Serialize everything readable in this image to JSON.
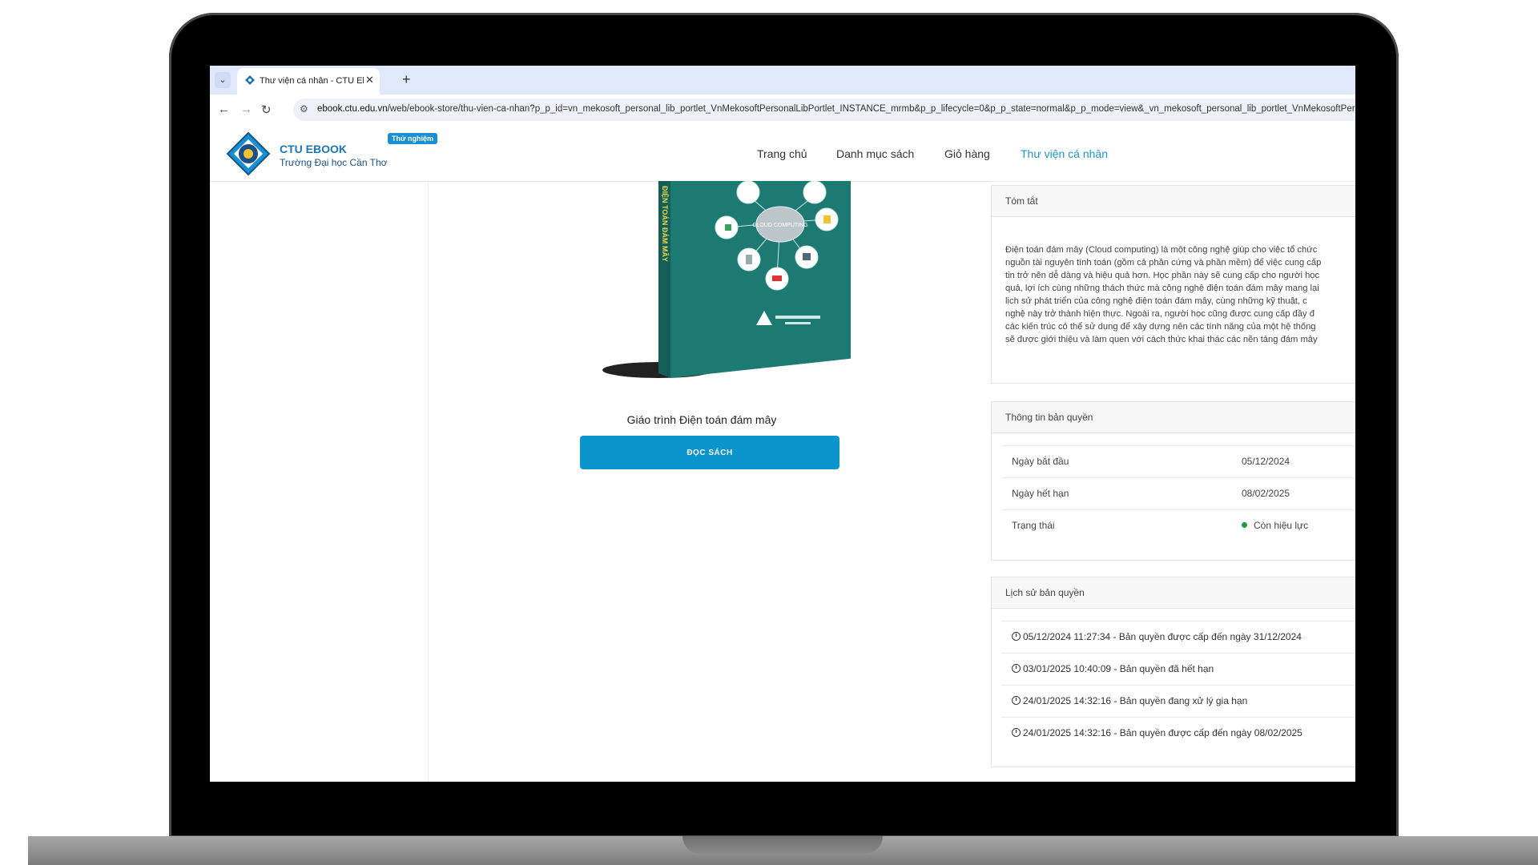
{
  "browser": {
    "tab_title": "Thư viện cá nhân - CTU Ebook",
    "url_domain": "ebook.ctu.edu.vn",
    "url_path": "/web/ebook-store/thu-vien-ca-nhan?p_p_id=vn_mekosoft_personal_lib_portlet_VnMekosoftPersonalLibPortlet_INSTANCE_mrmb&p_p_lifecycle=0&p_p_state=normal&p_p_mode=view&_vn_mekosoft_personal_lib_portlet_VnMekosoftPersonalLibPortlet"
  },
  "site": {
    "brand_title": "CTU EBOOK",
    "brand_subtitle": "Trường Đại học Cần Thơ",
    "beta_badge": "Thử nghiệm",
    "nav": [
      "Trang chủ",
      "Danh mục sách",
      "Giỏ hàng",
      "Thư viện cá nhân"
    ],
    "active_nav": "Thư viện cá nhân"
  },
  "book": {
    "title": "Giáo trình Điện toán đám mây",
    "read_button": "ĐỌC SÁCH",
    "cover_spine_text": "ĐIỆN TOÁN ĐÁM MÂY",
    "cover_cloud_text": "CLOUD COMPUTING"
  },
  "summary": {
    "heading": "Tóm tắt",
    "lines": [
      "Điện toán đám mây (Cloud computing) là một công nghệ giúp cho việc tổ chức",
      "nguồn tài nguyên tính toán (gồm cả phần cứng và phần mềm) để việc cung cấp",
      "tin trở nên dễ dàng và hiệu quả hơn. Học phần này sẽ cung cấp cho người học",
      "quả, lợi ích cùng những thách thức mà công nghệ điện toán đám mây mang lại",
      "lịch sử phát triển của công nghệ điện toán đám mây, cùng những kỹ thuật, c",
      "nghệ này trở thành hiện thực. Ngoài ra, người học cũng được cung cấp đầy đ",
      "các kiến trúc có thể sử dụng để xây dựng nên các tính năng của một hệ thống",
      "sẽ được giới thiệu và làm quen với cách thức khai thác các nền tảng đám mây"
    ]
  },
  "license": {
    "heading": "Thông tin bản quyền",
    "start_label": "Ngày bắt đầu",
    "start_value": "05/12/2024",
    "end_label": "Ngày hết hạn",
    "end_value": "08/02/2025",
    "status_label": "Trạng thái",
    "status_value": "Còn hiệu lực",
    "status_color": "#1f9d3a"
  },
  "history": {
    "heading": "Lịch sử bản quyền",
    "entries": [
      "05/12/2024 11:27:34 - Bản quyền được cấp đến ngày 31/12/2024",
      "03/01/2025 10:40:09 - Bản quyền đã hết hạn",
      "24/01/2025 14:32:16 - Bản quyền đang xử lý gia hạn",
      "24/01/2025 14:32:16 - Bản quyền được cấp đến ngày 08/02/2025"
    ]
  },
  "colors": {
    "accent": "#0a95cd",
    "brand": "#1a78b8",
    "cover": "#1d7a72"
  }
}
